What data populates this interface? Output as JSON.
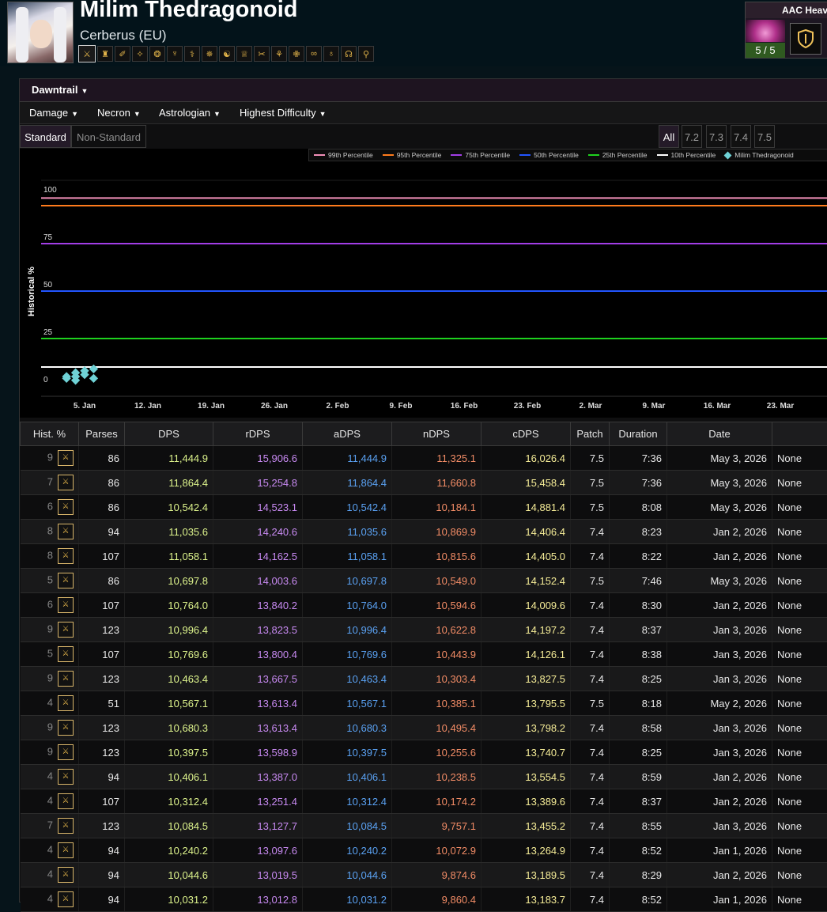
{
  "header": {
    "name": "Milim Thedragonoid",
    "server": "Cerberus (EU)",
    "jobs": [
      "⚔",
      "♜",
      "✐",
      "✧",
      "❂",
      "♆",
      "⚕",
      "✵",
      "☯",
      "♕",
      "✂",
      "⚘",
      "✙",
      "∞",
      "♁",
      "☊",
      "⚲"
    ],
    "raid": {
      "name": "AAC Heavy",
      "kills": "5 / 5"
    }
  },
  "filters": {
    "expansion": "Dawntrail",
    "metric": "Damage",
    "encounter": "Necron",
    "spec": "Astrologian",
    "difficulty": "Highest Difficulty",
    "standard": "Standard",
    "nonstandard": "Non-Standard",
    "patches": [
      "All",
      "7.2",
      "7.3",
      "7.4",
      "7.5"
    ]
  },
  "chart_data": {
    "type": "line",
    "ylabel": "Historical %",
    "yticks": [
      "0",
      "25",
      "50",
      "75",
      "100"
    ],
    "xticks": [
      "5. Jan",
      "12. Jan",
      "19. Jan",
      "26. Jan",
      "2. Feb",
      "9. Feb",
      "16. Feb",
      "23. Feb",
      "2. Mar",
      "9. Mar",
      "16. Mar",
      "23. Mar"
    ],
    "ylim": [
      0,
      100
    ],
    "series": [
      {
        "name": "99th Percentile",
        "value": 99,
        "color": "#f28fb8"
      },
      {
        "name": "95th Percentile",
        "value": 95,
        "color": "#ff7b1c"
      },
      {
        "name": "75th Percentile",
        "value": 75,
        "color": "#a23de6"
      },
      {
        "name": "50th Percentile",
        "value": 50,
        "color": "#2255ff"
      },
      {
        "name": "25th Percentile",
        "value": 25,
        "color": "#1ed11e"
      },
      {
        "name": "10th Percentile",
        "value": 10,
        "color": "#ffffff"
      },
      {
        "name": "Milim Thedragonoid",
        "color": "#6fd2d6",
        "points": [
          {
            "x": "3. Jan",
            "y": 4
          },
          {
            "x": "3. Jan",
            "y": 5
          },
          {
            "x": "4. Jan",
            "y": 5
          },
          {
            "x": "4. Jan",
            "y": 7
          },
          {
            "x": "5. Jan",
            "y": 6
          },
          {
            "x": "5. Jan",
            "y": 8
          },
          {
            "x": "6. Jan",
            "y": 9
          },
          {
            "x": "6. Jan",
            "y": 4
          },
          {
            "x": "4. Jan",
            "y": 3
          }
        ]
      }
    ]
  },
  "table": {
    "headers": [
      "Hist. %",
      "Parses",
      "DPS",
      "rDPS",
      "aDPS",
      "nDPS",
      "cDPS",
      "Patch",
      "Duration",
      "Date",
      ""
    ],
    "rows": [
      [
        "9",
        "86",
        "11,444.9",
        "15,906.6",
        "11,444.9",
        "11,325.1",
        "16,026.4",
        "7.5",
        "7:36",
        "May 3, 2026",
        "None"
      ],
      [
        "7",
        "86",
        "11,864.4",
        "15,254.8",
        "11,864.4",
        "11,660.8",
        "15,458.4",
        "7.5",
        "7:36",
        "May 3, 2026",
        "None"
      ],
      [
        "6",
        "86",
        "10,542.4",
        "14,523.1",
        "10,542.4",
        "10,184.1",
        "14,881.4",
        "7.5",
        "8:08",
        "May 3, 2026",
        "None"
      ],
      [
        "8",
        "94",
        "11,035.6",
        "14,240.6",
        "11,035.6",
        "10,869.9",
        "14,406.4",
        "7.4",
        "8:23",
        "Jan 2, 2026",
        "None"
      ],
      [
        "8",
        "107",
        "11,058.1",
        "14,162.5",
        "11,058.1",
        "10,815.6",
        "14,405.0",
        "7.4",
        "8:22",
        "Jan 2, 2026",
        "None"
      ],
      [
        "5",
        "86",
        "10,697.8",
        "14,003.6",
        "10,697.8",
        "10,549.0",
        "14,152.4",
        "7.5",
        "7:46",
        "May 3, 2026",
        "None"
      ],
      [
        "6",
        "107",
        "10,764.0",
        "13,840.2",
        "10,764.0",
        "10,594.6",
        "14,009.6",
        "7.4",
        "8:30",
        "Jan 2, 2026",
        "None"
      ],
      [
        "9",
        "123",
        "10,996.4",
        "13,823.5",
        "10,996.4",
        "10,622.8",
        "14,197.2",
        "7.4",
        "8:37",
        "Jan 3, 2026",
        "None"
      ],
      [
        "5",
        "107",
        "10,769.6",
        "13,800.4",
        "10,769.6",
        "10,443.9",
        "14,126.1",
        "7.4",
        "8:38",
        "Jan 3, 2026",
        "None"
      ],
      [
        "9",
        "123",
        "10,463.4",
        "13,667.5",
        "10,463.4",
        "10,303.4",
        "13,827.5",
        "7.4",
        "8:25",
        "Jan 3, 2026",
        "None"
      ],
      [
        "4",
        "51",
        "10,567.1",
        "13,613.4",
        "10,567.1",
        "10,385.1",
        "13,795.5",
        "7.5",
        "8:18",
        "May 2, 2026",
        "None"
      ],
      [
        "9",
        "123",
        "10,680.3",
        "13,613.4",
        "10,680.3",
        "10,495.4",
        "13,798.2",
        "7.4",
        "8:58",
        "Jan 3, 2026",
        "None"
      ],
      [
        "9",
        "123",
        "10,397.5",
        "13,598.9",
        "10,397.5",
        "10,255.6",
        "13,740.7",
        "7.4",
        "8:25",
        "Jan 3, 2026",
        "None"
      ],
      [
        "4",
        "94",
        "10,406.1",
        "13,387.0",
        "10,406.1",
        "10,238.5",
        "13,554.5",
        "7.4",
        "8:59",
        "Jan 2, 2026",
        "None"
      ],
      [
        "4",
        "107",
        "10,312.4",
        "13,251.4",
        "10,312.4",
        "10,174.2",
        "13,389.6",
        "7.4",
        "8:37",
        "Jan 2, 2026",
        "None"
      ],
      [
        "7",
        "123",
        "10,084.5",
        "13,127.7",
        "10,084.5",
        "9,757.1",
        "13,455.2",
        "7.4",
        "8:55",
        "Jan 3, 2026",
        "None"
      ],
      [
        "4",
        "94",
        "10,240.2",
        "13,097.6",
        "10,240.2",
        "10,072.9",
        "13,264.9",
        "7.4",
        "8:52",
        "Jan 1, 2026",
        "None"
      ],
      [
        "4",
        "94",
        "10,044.6",
        "13,019.5",
        "10,044.6",
        "9,874.6",
        "13,189.5",
        "7.4",
        "8:29",
        "Jan 2, 2026",
        "None"
      ],
      [
        "4",
        "94",
        "10,031.2",
        "13,012.8",
        "10,031.2",
        "9,860.4",
        "13,183.7",
        "7.4",
        "8:52",
        "Jan 1, 2026",
        "None"
      ]
    ]
  }
}
